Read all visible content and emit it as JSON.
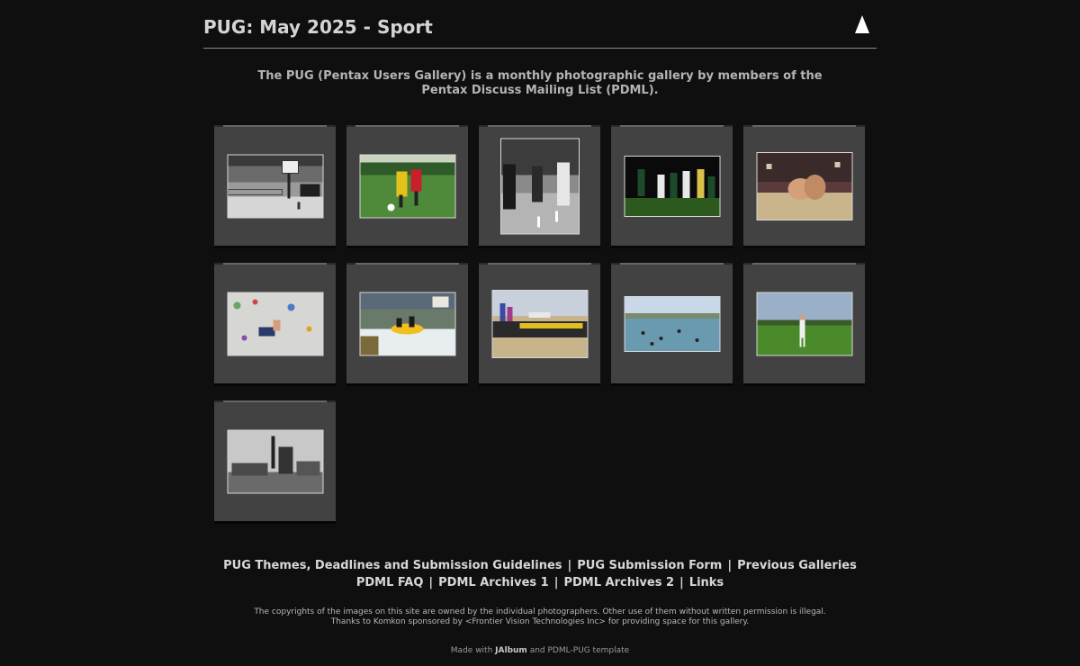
{
  "title": "PUG: May 2025 - Sport",
  "intro": [
    "The PUG (Pentax Users Gallery) is a monthly photographic gallery by members of the",
    "Pentax Discuss Mailing List (PDML)."
  ],
  "nav_line1": [
    "PUG Themes, Deadlines and Submission Guidelines",
    "PUG Submission Form",
    "Previous Galleries"
  ],
  "nav_line2": [
    "PDML FAQ",
    "PDML Archives 1",
    "PDML Archives 2",
    "Links"
  ],
  "nav_separator": "|",
  "copyright": [
    "The copyrights of the images on this site are owned by the individual photographers. Other use of them without written permission is illegal.",
    "Thanks to Komkon sponsored by <Frontier Vision Technologies Inc> for providing space for this gallery."
  ],
  "made_with": {
    "prefix": "Made with",
    "brand": "JAlbum",
    "suffix": "and PDML-PUG template"
  }
}
